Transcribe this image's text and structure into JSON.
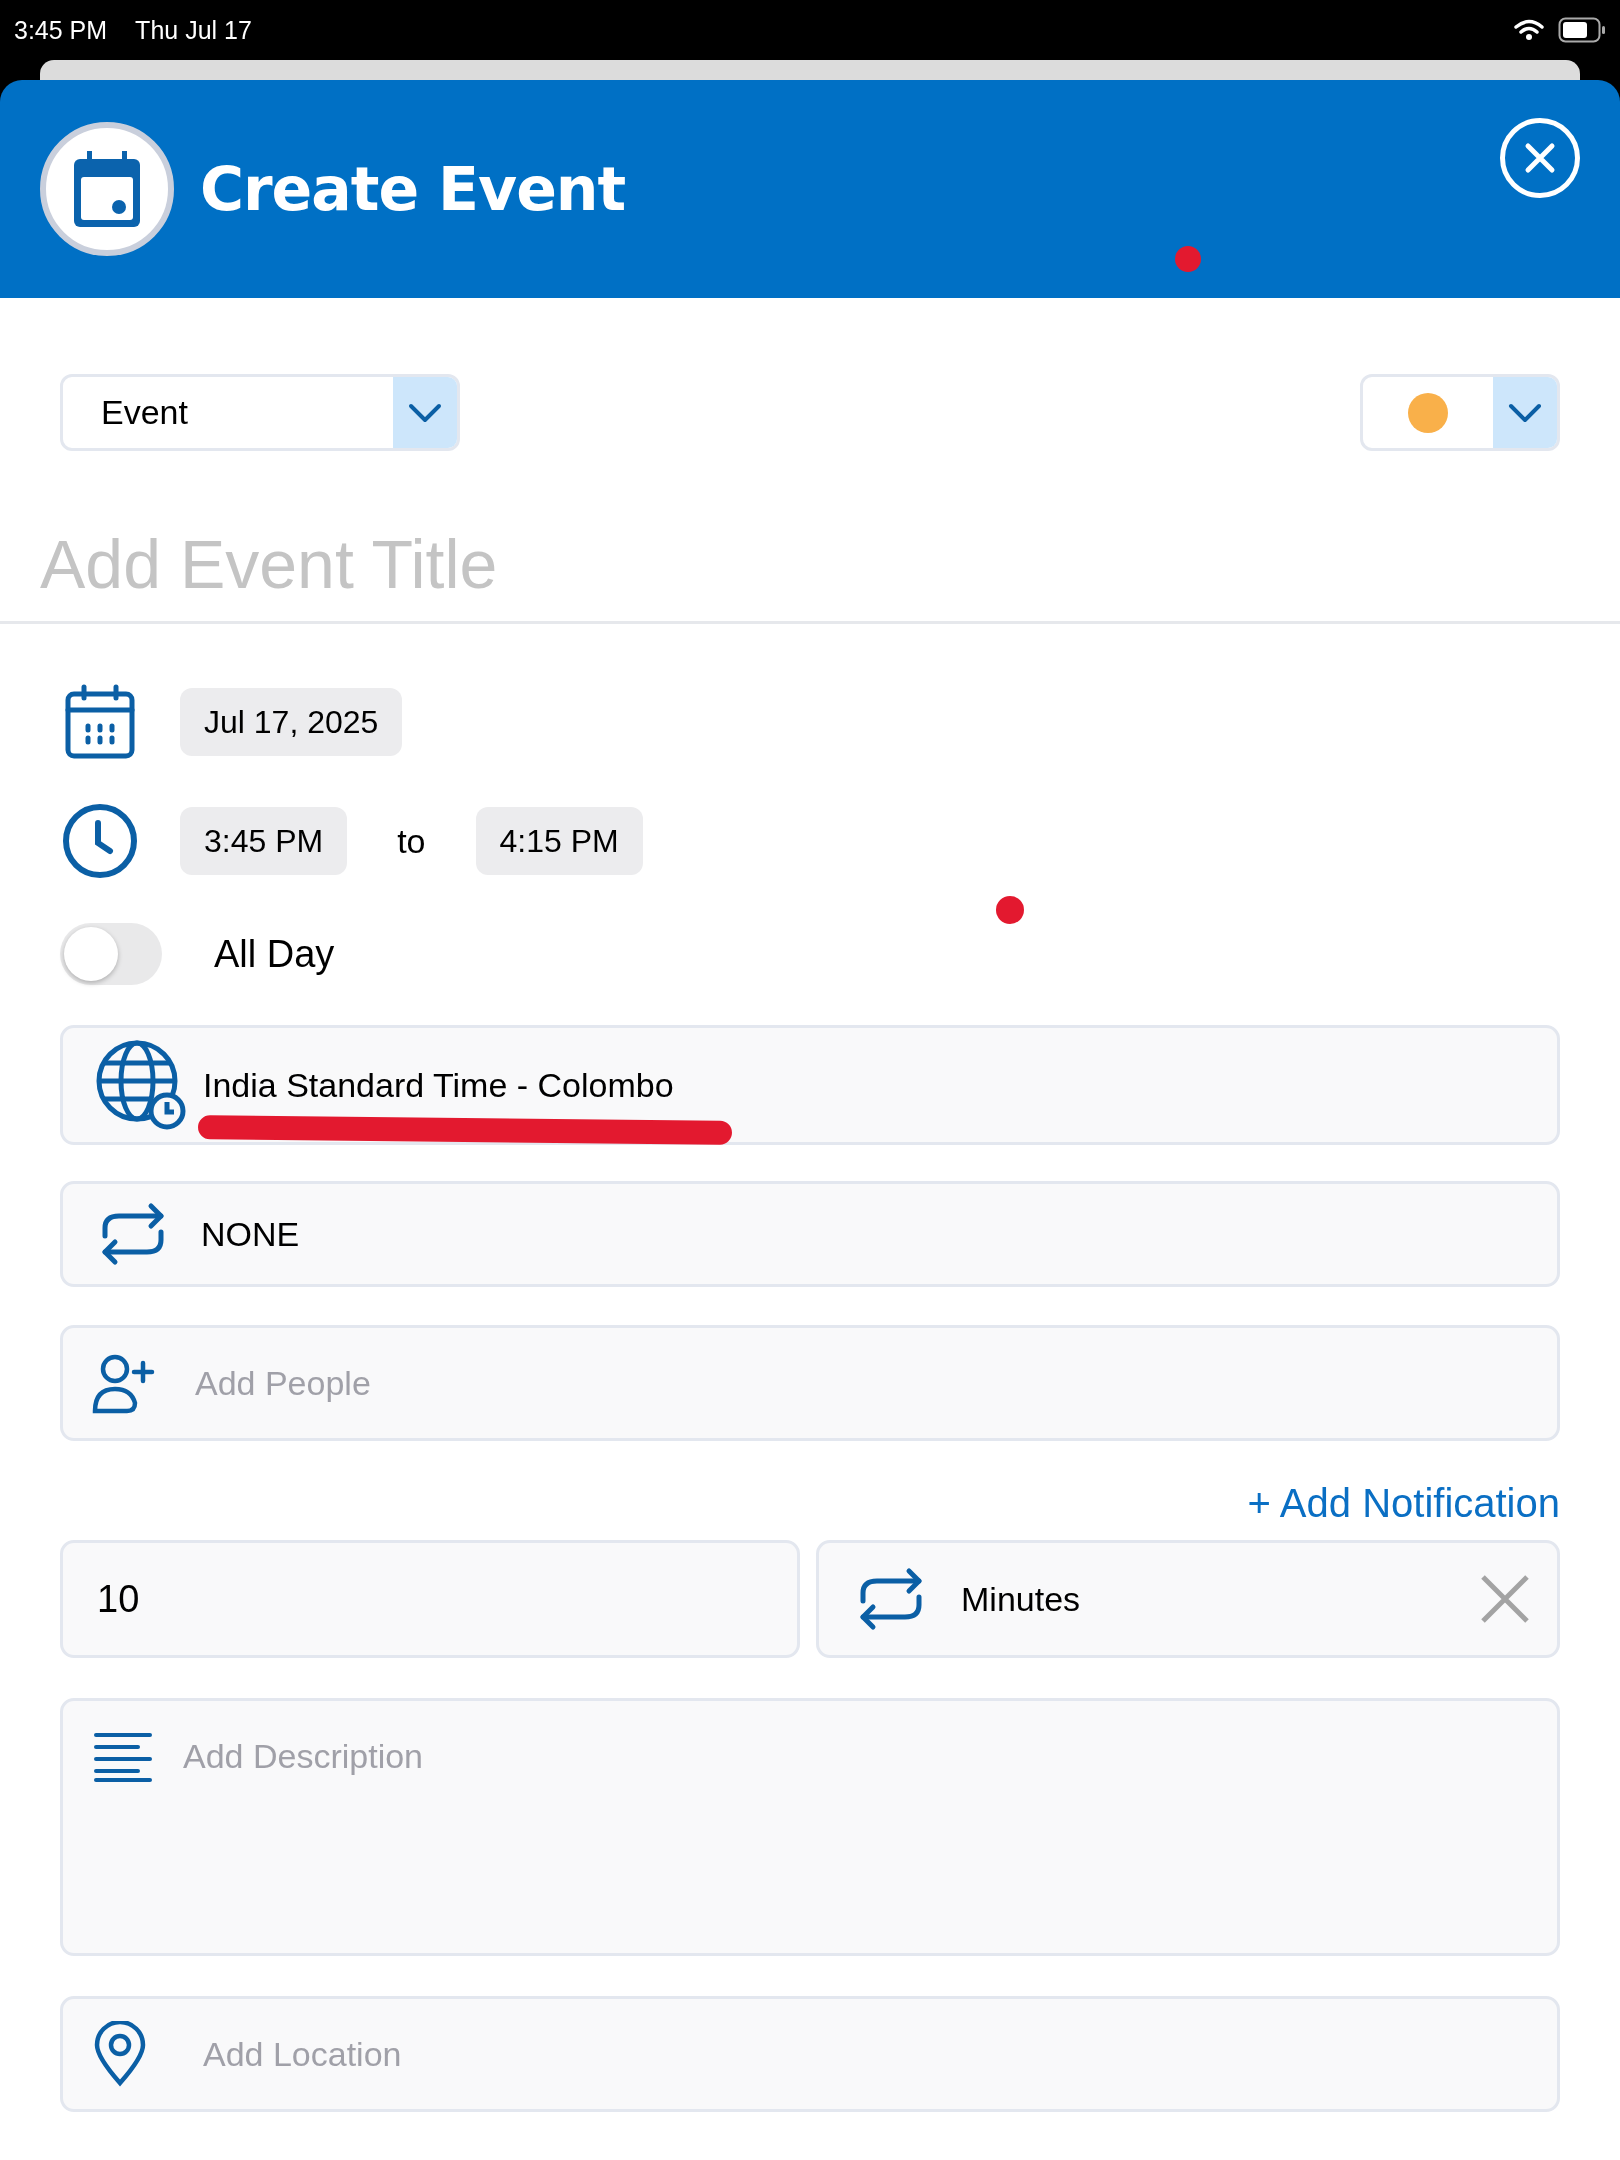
{
  "status_bar": {
    "time": "3:45 PM",
    "date": "Thu Jul 17"
  },
  "header": {
    "title": "Create Event"
  },
  "type_select": {
    "value": "Event"
  },
  "color_select": {
    "color": "#f9b04a"
  },
  "title_field": {
    "placeholder": "Add Event Title"
  },
  "date": "Jul 17, 2025",
  "start_time": "3:45 PM",
  "to_label": "to",
  "end_time": "4:15 PM",
  "all_day": {
    "label": "All Day",
    "on": false
  },
  "timezone": {
    "value": "India Standard Time - Colombo"
  },
  "repeat": {
    "value": "NONE"
  },
  "people": {
    "placeholder": "Add People"
  },
  "add_notification": "+ Add Notification",
  "notification": {
    "amount": "10",
    "unit": "Minutes"
  },
  "description": {
    "placeholder": "Add Description"
  },
  "location": {
    "placeholder": "Add Location"
  },
  "annotations": [
    {
      "kind": "dot"
    },
    {
      "kind": "dot"
    },
    {
      "kind": "underline"
    }
  ]
}
